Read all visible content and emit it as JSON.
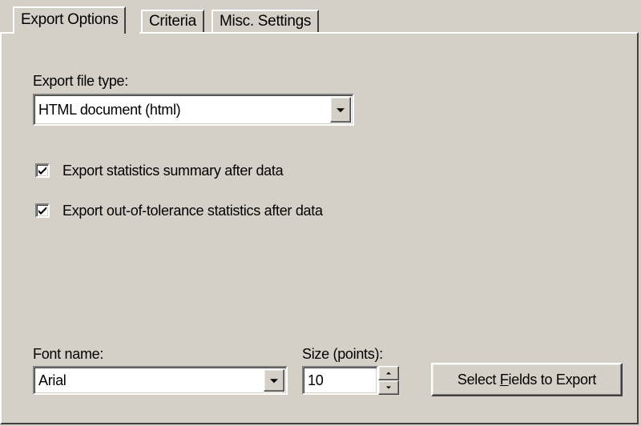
{
  "tabs": [
    {
      "label": "Export Options",
      "active": true
    },
    {
      "label": "Criteria",
      "active": false
    },
    {
      "label": "Misc. Settings",
      "active": false
    }
  ],
  "export_file_type": {
    "label": "Export file type:",
    "selected": "HTML document (html)"
  },
  "checkboxes": [
    {
      "label": "Export statistics summary after data",
      "checked": true
    },
    {
      "label": "Export out-of-tolerance statistics after data",
      "checked": true
    }
  ],
  "font_name": {
    "label": "Font name:",
    "selected": "Arial"
  },
  "font_size": {
    "label": "Size (points):",
    "value": "10"
  },
  "select_fields_button": {
    "label_before": "Select ",
    "mnemonic": "F",
    "label_after": "ields to Export"
  },
  "colors": {
    "dialog_face": "#d4d0c8",
    "field_background": "#ffffff",
    "text": "#000000"
  }
}
